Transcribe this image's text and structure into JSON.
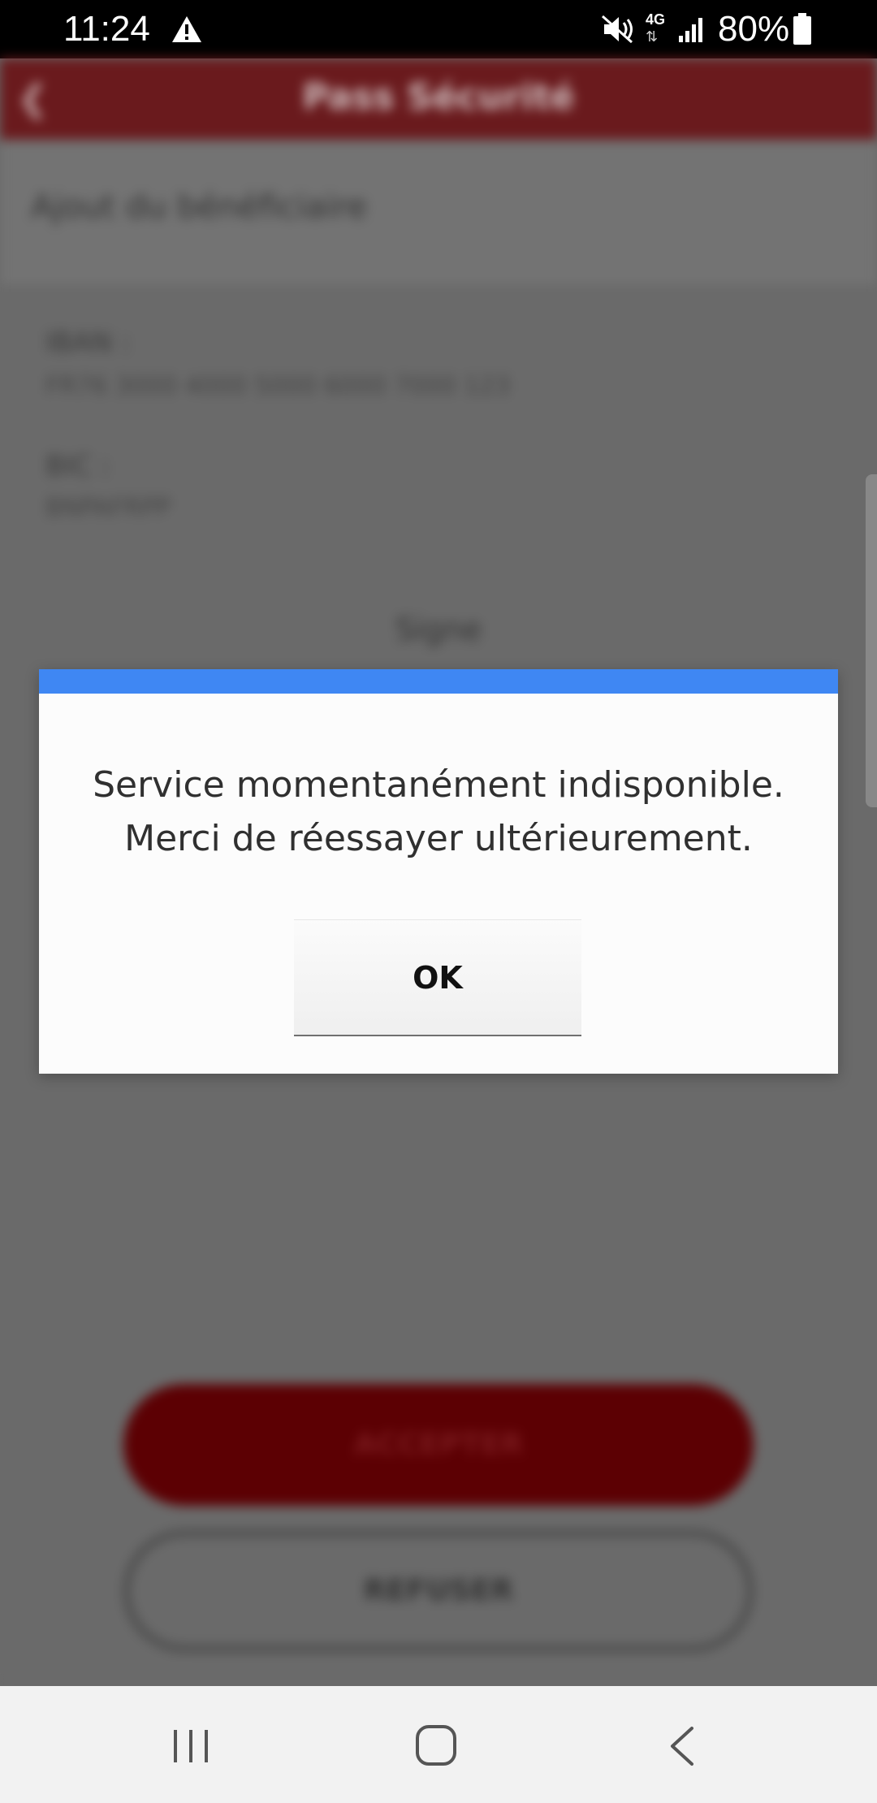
{
  "status_bar": {
    "time": "11:24",
    "network": "4G",
    "battery": "80%",
    "icons": [
      "warning-icon",
      "mute-icon",
      "signal-icon",
      "battery-icon"
    ]
  },
  "app": {
    "title": "Pass Sécurité",
    "section_title": "Ajout du bénéficiaire",
    "iban_label": "IBAN :",
    "iban_value": "FR76 3000 4000 5000 6000 7000 123",
    "bic_label": "BIC :",
    "bic_value": "BNPAFRPP",
    "signature_label": "Signe",
    "accept_label": "ACCEPTER",
    "decline_label": "REFUSER",
    "header_color": "#6a1a1d",
    "accept_color": "#5c0003"
  },
  "dialog": {
    "accent_color": "#3f87f3",
    "message_line1": "Service momentanément indisponible.",
    "message_line2": "Merci de réessayer ultérieurement.",
    "ok_label": "OK"
  },
  "nav_bar": {
    "icons": [
      "recent-apps-icon",
      "home-icon",
      "back-icon"
    ]
  }
}
